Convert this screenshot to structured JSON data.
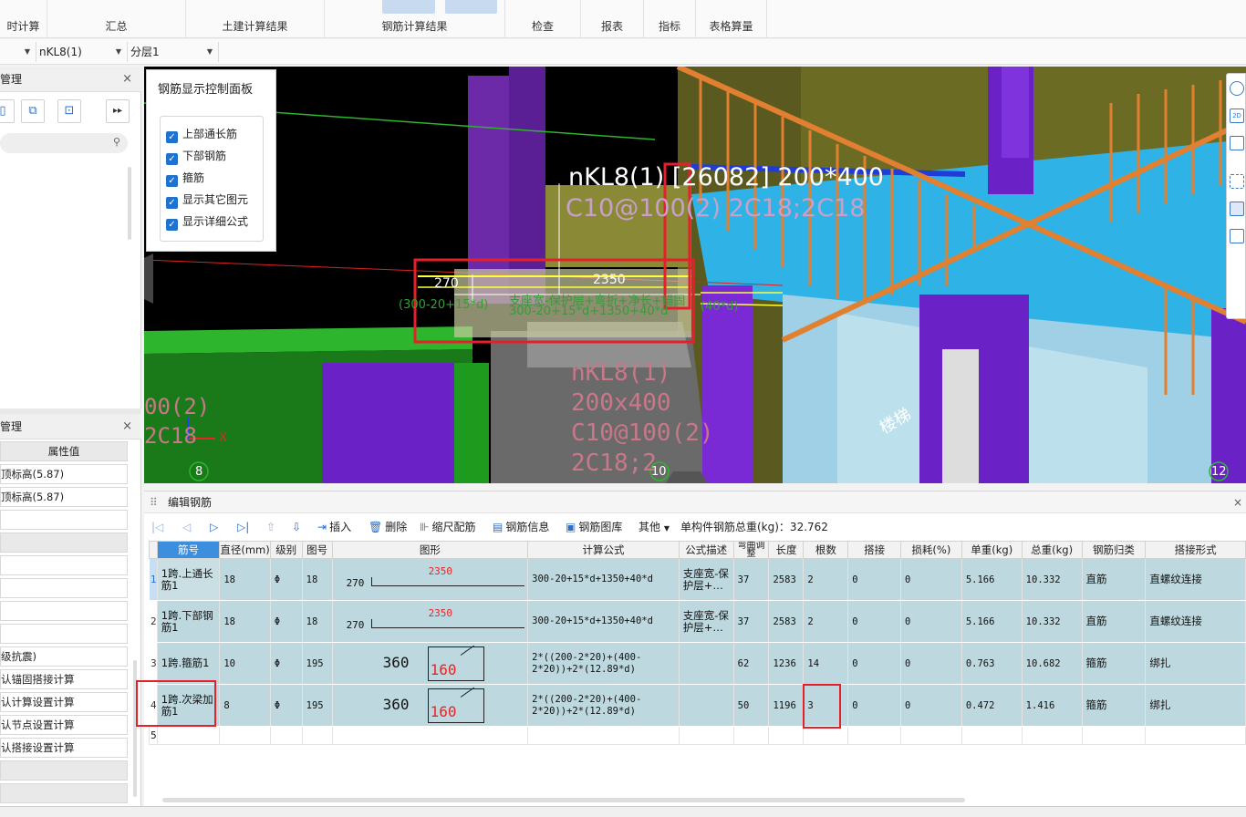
{
  "ribbon": {
    "tabs": [
      "时计算",
      "汇总",
      "土建计算结果",
      "钢筋计算结果",
      "检查",
      "报表",
      "指标",
      "表格算量"
    ]
  },
  "filters": {
    "first": "",
    "component": "nKL8(1)",
    "layer": "分层1"
  },
  "left_panel_top": {
    "title": "管理",
    "close": "×"
  },
  "left_panel_bottom": {
    "title": "管理",
    "close": "×",
    "header": "属性值",
    "rows": [
      "顶标高(5.87)",
      "顶标高(5.87)",
      "",
      "",
      "",
      "",
      "",
      "",
      "级抗震)",
      "认锚固搭接计算",
      "认计算设置计算",
      "认节点设置计算",
      "认搭接设置计算",
      "",
      ""
    ]
  },
  "viewport": {
    "beam_label_1": "nKL8(1) [26082] 200*400",
    "beam_label_2": "C10@100(2) 2C18;2C18",
    "dim_left": "270",
    "dim_main": "2350",
    "formula_left": "(300-20+15*d)",
    "formula_mid": "支座宽-保护层+弯折+净长+锚固",
    "formula_mid2": "300-20+15*d+1350+40*d",
    "formula_right": "(40*d)",
    "floor_text": [
      "nKL8(1)",
      "200x400",
      "C10@100(2)",
      "2C18;2"
    ],
    "left_text": [
      "00(2)",
      "2C18"
    ],
    "stair_text": "楼梯",
    "axis_x": "X",
    "grid_8": "8",
    "grid_10": "10",
    "grid_12": "12"
  },
  "control_panel": {
    "title": "钢筋显示控制面板",
    "options": [
      "上部通长筋",
      "下部钢筋",
      "箍筋",
      "显示其它图元",
      "显示详细公式"
    ]
  },
  "edit_panel": {
    "title": "编辑钢筋",
    "toolbar": {
      "insert": "插入",
      "delete": "删除",
      "scale": "缩尺配筋",
      "info": "钢筋信息",
      "library": "钢筋图库",
      "other": "其他",
      "total": "单构件钢筋总重(kg)：32.762"
    },
    "headers": [
      "筋号",
      "直径(mm)",
      "级别",
      "图号",
      "图形",
      "计算公式",
      "公式描述",
      "弯曲调整",
      "长度",
      "根数",
      "搭接",
      "损耗(%)",
      "单重(kg)",
      "总重(kg)",
      "钢筋归类",
      "搭接形式"
    ],
    "rows": [
      {
        "n": "1",
        "name": "1跨.上通长筋1",
        "dia": "18",
        "grade": "Φ",
        "fig": "18",
        "shape_a": "270",
        "shape_b": "2350",
        "formula": "300-20+15*d+1350+40*d",
        "desc": "支座宽-保护层+…",
        "bend": "37",
        "len": "2583",
        "count": "2",
        "lap": "0",
        "loss": "0",
        "unit": "5.166",
        "total": "10.332",
        "cat": "直筋",
        "laptype": "直螺纹连接"
      },
      {
        "n": "2",
        "name": "1跨.下部钢筋1",
        "dia": "18",
        "grade": "Φ",
        "fig": "18",
        "shape_a": "270",
        "shape_b": "2350",
        "formula": "300-20+15*d+1350+40*d",
        "desc": "支座宽-保护层+…",
        "bend": "37",
        "len": "2583",
        "count": "2",
        "lap": "0",
        "loss": "0",
        "unit": "5.166",
        "total": "10.332",
        "cat": "直筋",
        "laptype": "直螺纹连接"
      },
      {
        "n": "3",
        "name": "1跨.箍筋1",
        "dia": "10",
        "grade": "Φ",
        "fig": "195",
        "shape_a": "360",
        "shape_b": "160",
        "formula": "2*((200-2*20)+(400-2*20))+2*(12.89*d)",
        "desc": "",
        "bend": "62",
        "len": "1236",
        "count": "14",
        "lap": "0",
        "loss": "0",
        "unit": "0.763",
        "total": "10.682",
        "cat": "箍筋",
        "laptype": "绑扎"
      },
      {
        "n": "4",
        "name": "1跨.次梁加筋1",
        "dia": "8",
        "grade": "Φ",
        "fig": "195",
        "shape_a": "360",
        "shape_b": "160",
        "formula": "2*((200-2*20)+(400-2*20))+2*(12.89*d)",
        "desc": "",
        "bend": "50",
        "len": "1196",
        "count": "3",
        "lap": "0",
        "loss": "0",
        "unit": "0.472",
        "total": "1.416",
        "cat": "箍筋",
        "laptype": "绑扎"
      }
    ],
    "empty_row": "5"
  },
  "colors": {
    "accent": "#3c8ede",
    "row_bg": "#bdd9df",
    "highlight_box": "#e5202a"
  }
}
